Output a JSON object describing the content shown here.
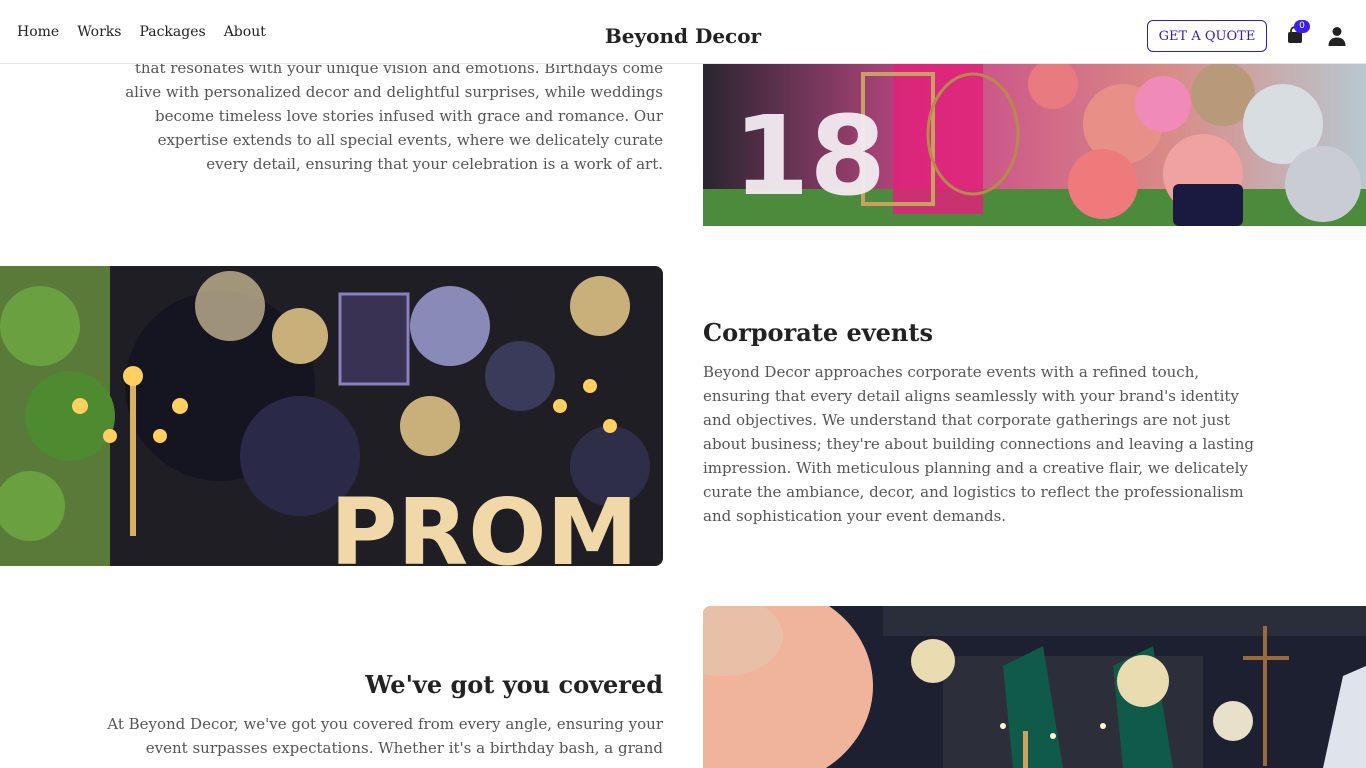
{
  "nav": {
    "links": [
      "Home",
      "Works",
      "Packages",
      "About"
    ],
    "brand": "Beyond Decor",
    "quote_button": "GET A QUOTE",
    "cart_count": "0",
    "accent_color": "#3b1aa8"
  },
  "sections": {
    "birthdays": {
      "text": "that resonates with your unique vision and emotions. Birthdays come alive with personalized decor and delightful surprises, while weddings become timeless love stories infused with grace and romance. Our expertise extends to all special events, where we delicately curate every detail, ensuring that your celebration is a work of art.",
      "image_caption": "18"
    },
    "corporate": {
      "title": "Corporate events",
      "text": "Beyond Decor approaches corporate events with a refined touch, ensuring that every detail aligns seamlessly with your brand's identity and objectives. We understand that corporate gatherings are not just about business; they're about building connections and leaving a lasting impression. With meticulous planning and a creative flair, we delicately curate the ambiance, decor, and logistics to reflect the professionalism and sophistication your event demands.",
      "image_caption": "PROM"
    },
    "covered": {
      "title": "We've got you covered",
      "text": "At Beyond Decor, we've got you covered from every angle, ensuring your event surpasses expectations. Whether it's a birthday bash, a grand"
    }
  },
  "icons": {
    "cart": "shopping-bag-icon",
    "user": "user-icon"
  }
}
